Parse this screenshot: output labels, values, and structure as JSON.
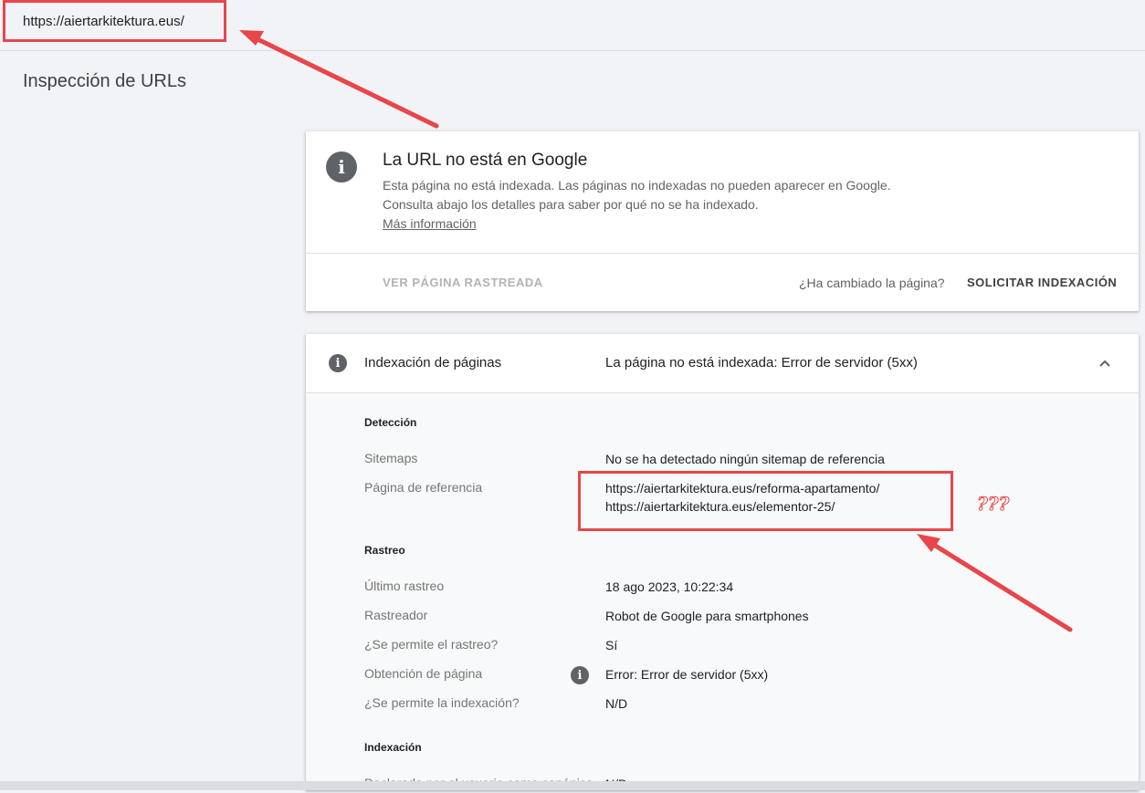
{
  "address_bar": {
    "url": "https://aiertarkitektura.eus/"
  },
  "page": {
    "title": "Inspección de URLs"
  },
  "status_card": {
    "title": "La URL no está en Google",
    "description": "Esta página no está indexada. Las páginas no indexadas no pueden aparecer en Google. Consulta abajo los detalles para saber por qué no se ha indexado.",
    "learn_more": "Más información",
    "view_crawled": "VER PÁGINA RASTREADA",
    "changed_question": "¿Ha cambiado la página?",
    "request_indexing": "SOLICITAR INDEXACIÓN"
  },
  "indexing_panel": {
    "label": "Indexación de páginas",
    "status": "La página no está indexada: Error de servidor (5xx)",
    "sections": {
      "detection": {
        "heading": "Detección",
        "sitemaps_label": "Sitemaps",
        "sitemaps_value": "No se ha detectado ningún sitemap de referencia",
        "referring_label": "Página de referencia",
        "referring_values": [
          "https://aiertarkitektura.eus/reforma-apartamento/",
          "https://aiertarkitektura.eus/elementor-25/"
        ]
      },
      "crawl": {
        "heading": "Rastreo",
        "last_crawl_label": "Último rastreo",
        "last_crawl_value": "18 ago 2023, 10:22:34",
        "crawler_label": "Rastreador",
        "crawler_value": "Robot de Google para smartphones",
        "crawl_allowed_label": "¿Se permite el rastreo?",
        "crawl_allowed_value": "Sí",
        "page_fetch_label": "Obtención de página",
        "page_fetch_value": "Error: Error de servidor (5xx)",
        "indexing_allowed_label": "¿Se permite la indexación?",
        "indexing_allowed_value": "N/D"
      },
      "indexing": {
        "heading": "Indexación",
        "declared_label": "Declarada por el usuario como canónica",
        "declared_value": "N/D"
      }
    }
  },
  "annotation": {
    "question_marks": "???"
  },
  "colors": {
    "annotation_red": "#e8464a",
    "icon_gray": "#5f6368"
  },
  "icons": {
    "info": "info-icon",
    "collapse": "chevron-up-icon"
  }
}
